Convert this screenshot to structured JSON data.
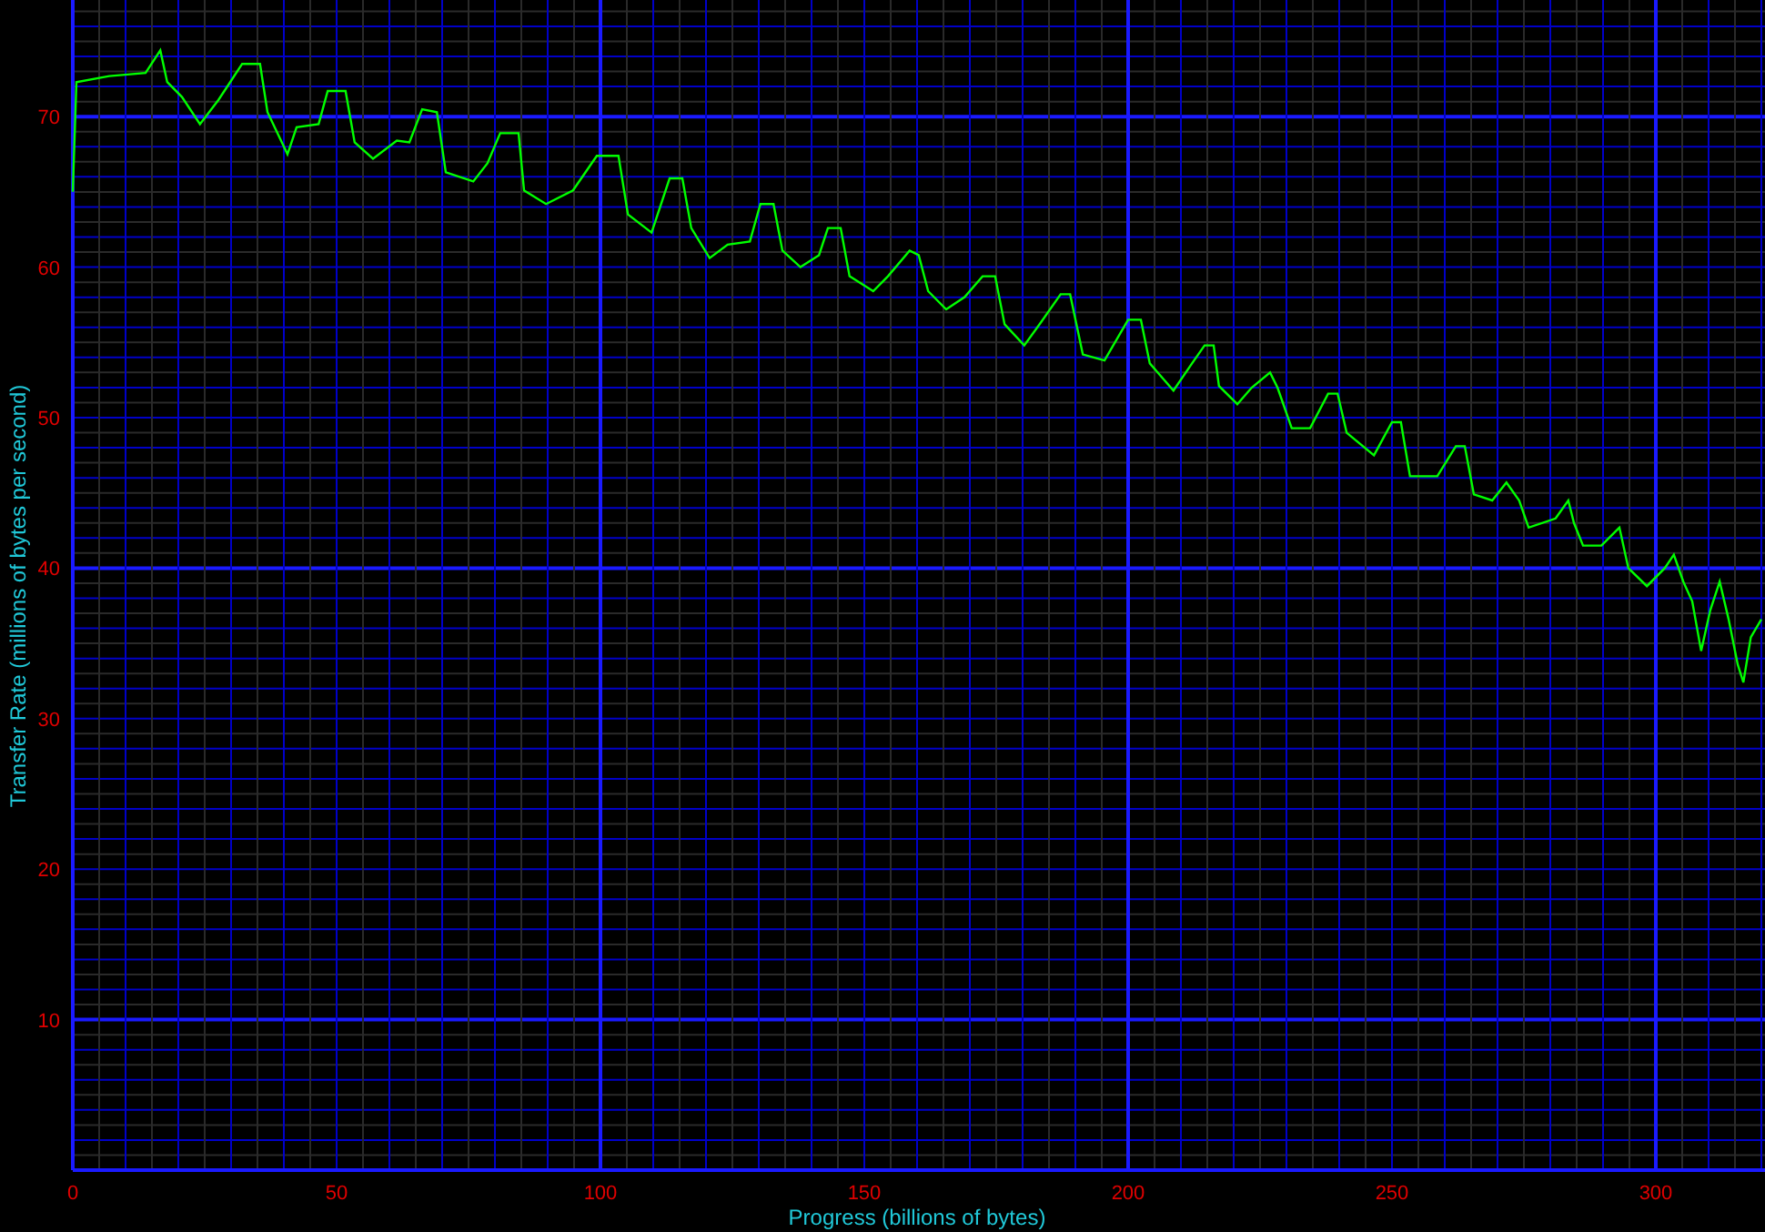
{
  "chart_data": {
    "type": "line",
    "grid": true,
    "xlabel": "Progress (billions of bytes)",
    "ylabel": "Transfer Rate (millions of bytes per second)",
    "xlim": [
      0,
      320
    ],
    "ylim": [
      0,
      77.75
    ],
    "xticks": [
      0,
      50,
      100,
      150,
      200,
      250,
      300
    ],
    "yticks": [
      10,
      20,
      30,
      40,
      50,
      60,
      70
    ],
    "x": [
      0,
      0.7,
      6.9,
      13.8,
      16.6,
      17.9,
      20.7,
      24.1,
      27.6,
      32.1,
      35.5,
      36.9,
      40.7,
      42.4,
      46.6,
      48.3,
      51.7,
      53.4,
      56.9,
      61.4,
      63.8,
      66.2,
      69.0,
      70.7,
      75.9,
      78.6,
      81.0,
      84.5,
      85.5,
      89.7,
      94.8,
      99.3,
      103.4,
      105.2,
      109.7,
      113.1,
      115.5,
      117.2,
      120.7,
      124.1,
      128.3,
      130.3,
      132.8,
      134.5,
      137.9,
      141.4,
      143.1,
      145.5,
      147.2,
      151.7,
      154.5,
      158.6,
      160.3,
      162.1,
      165.5,
      169.0,
      172.4,
      174.8,
      176.6,
      180.3,
      183.4,
      187.2,
      189.0,
      191.4,
      195.5,
      200.0,
      202.4,
      204.1,
      208.6,
      212.1,
      214.5,
      216.2,
      217.2,
      220.7,
      223.4,
      226.9,
      228.3,
      231.0,
      234.5,
      237.9,
      239.7,
      241.4,
      246.6,
      250.0,
      251.7,
      253.4,
      258.6,
      262.1,
      263.8,
      265.5,
      269.0,
      271.7,
      274.1,
      275.9,
      281.0,
      283.4,
      284.5,
      286.2,
      289.7,
      293.1,
      294.8,
      298.3,
      301.7,
      303.4,
      305.2,
      306.9,
      308.6,
      310.3,
      312.1,
      313.8,
      315.5,
      316.6,
      318.0,
      320.0
    ],
    "series": [
      {
        "color": "#00ff00",
        "values": [
          65.0,
          72.3,
          72.7,
          72.9,
          74.4,
          72.3,
          71.3,
          69.5,
          71.1,
          73.5,
          73.5,
          70.3,
          67.5,
          69.3,
          69.5,
          71.7,
          71.7,
          68.3,
          67.2,
          68.4,
          68.3,
          70.5,
          70.3,
          66.3,
          65.7,
          66.9,
          68.9,
          68.9,
          65.1,
          64.2,
          65.1,
          67.4,
          67.4,
          63.5,
          62.3,
          65.9,
          65.9,
          62.6,
          60.6,
          61.5,
          61.7,
          64.2,
          64.2,
          61.1,
          60.0,
          60.8,
          62.6,
          62.6,
          59.4,
          58.4,
          59.4,
          61.1,
          60.8,
          58.4,
          57.2,
          58.0,
          59.4,
          59.4,
          56.2,
          54.8,
          56.3,
          58.2,
          58.2,
          54.2,
          53.8,
          56.5,
          56.5,
          53.6,
          51.8,
          53.6,
          54.8,
          54.8,
          52.1,
          50.9,
          52.0,
          53.0,
          52.0,
          49.3,
          49.3,
          51.6,
          51.6,
          49.0,
          47.5,
          49.7,
          49.7,
          46.1,
          46.1,
          48.1,
          48.1,
          44.9,
          44.5,
          45.7,
          44.5,
          42.7,
          43.3,
          44.5,
          43.0,
          41.5,
          41.5,
          42.7,
          40.0,
          38.8,
          40.0,
          40.9,
          39.1,
          37.8,
          34.5,
          37.2,
          39.1,
          36.6,
          33.6,
          32.4,
          35.4,
          36.6
        ]
      }
    ]
  }
}
